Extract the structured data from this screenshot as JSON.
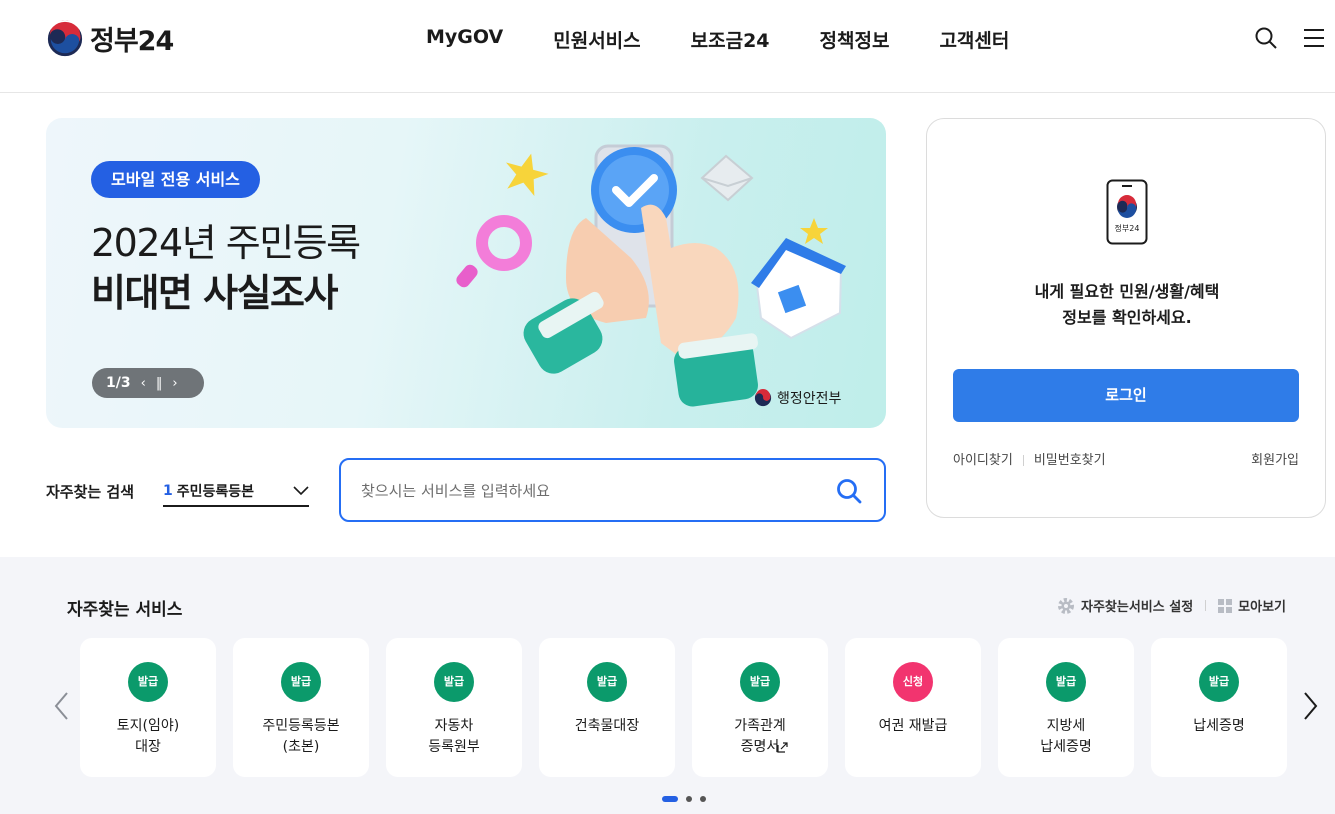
{
  "header": {
    "logo_text": "정부24",
    "nav": [
      "MyGOV",
      "민원서비스",
      "보조금24",
      "정책정보",
      "고객센터"
    ]
  },
  "banner": {
    "badge": "모바일 전용 서비스",
    "title_line1": "2024년 주민등록",
    "title_line2": "비대면 사실조사",
    "slide_counter": "1/3",
    "ministry": "행정안전부"
  },
  "search": {
    "label": "자주찾는 검색",
    "select_rank": "1",
    "select_value": "주민등록등본",
    "placeholder": "찾으시는 서비스를 입력하세요"
  },
  "login": {
    "phone_label": "정부24",
    "message_line1": "내게 필요한 민원/생활/혜택",
    "message_line2": "정보를 확인하세요.",
    "button": "로그인",
    "find_id": "아이디찾기",
    "find_password": "비밀번호찾기",
    "signup": "회원가입"
  },
  "services": {
    "title": "자주찾는 서비스",
    "settings": "자주찾는서비스 설정",
    "view_all": "모아보기",
    "items": [
      {
        "chip": "발급",
        "label": "토지(임야)\n대장",
        "color": "#0b9a6b"
      },
      {
        "chip": "발급",
        "label": "주민등록등본\n(초본)",
        "color": "#0b9a6b"
      },
      {
        "chip": "발급",
        "label": "자동차\n등록원부",
        "color": "#0b9a6b"
      },
      {
        "chip": "발급",
        "label": "건축물대장",
        "color": "#0b9a6b"
      },
      {
        "chip": "발급",
        "label": "가족관계\n증명서",
        "color": "#0b9a6b"
      },
      {
        "chip": "신청",
        "label": "여권 재발급",
        "color": "#f2346f"
      },
      {
        "chip": "발급",
        "label": "지방세\n납세증명",
        "color": "#0b9a6b"
      },
      {
        "chip": "발급",
        "label": "납세증명",
        "color": "#0b9a6b"
      }
    ]
  },
  "colors": {
    "primary": "#256ef4",
    "badge_blue": "#2460e3",
    "login_blue": "#2f7ce8",
    "issue_green": "#0b9a6b",
    "apply_pink": "#f2346f"
  }
}
